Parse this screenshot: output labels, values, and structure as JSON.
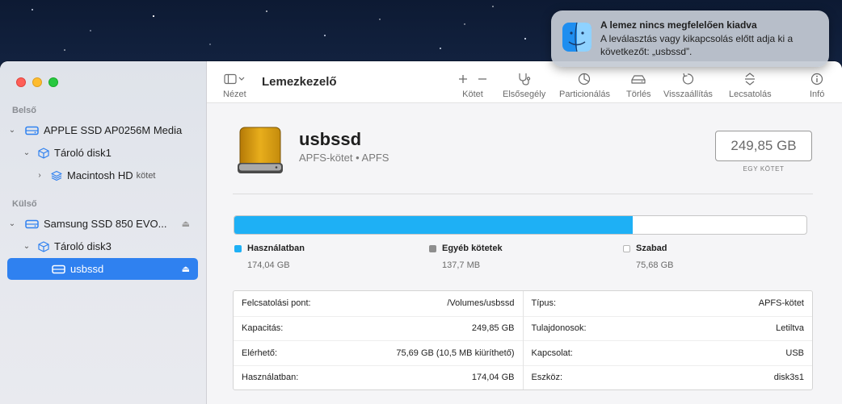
{
  "app": {
    "title": "Lemezkezelő"
  },
  "sidebar": {
    "sections": [
      {
        "title": "Belső"
      },
      {
        "title": "Külső"
      }
    ],
    "items": [
      {
        "label": "APPLE SSD AP0256M Media"
      },
      {
        "label": "Tároló disk1"
      },
      {
        "label": "Macintosh HD",
        "suffix": "kötet"
      },
      {
        "label": "Samsung SSD 850 EVO..."
      },
      {
        "label": "Tároló disk3"
      },
      {
        "label": "usbssd"
      }
    ]
  },
  "toolbar": {
    "view_label": "Nézet",
    "volume_label": "Kötet",
    "first_aid_label": "Elsősegély",
    "partition_label": "Particionálás",
    "erase_label": "Törlés",
    "restore_label": "Visszaállítás",
    "unmount_label": "Lecsatolás",
    "info_label": "Infó"
  },
  "volume": {
    "name": "usbssd",
    "subtitle": "APFS-kötet • APFS",
    "capacity": "249,85 GB",
    "capacity_caption": "EGY KÖTET",
    "usage_fraction": 0.6965
  },
  "legend": [
    {
      "label": "Használatban",
      "value": "174,04 GB",
      "color": "#1eb0f5"
    },
    {
      "label": "Egyéb kötetek",
      "value": "137,7 MB",
      "color": "#8e8e8e"
    },
    {
      "label": "Szabad",
      "value": "75,68 GB",
      "color": "#ffffff"
    }
  ],
  "info": {
    "left": [
      {
        "key": "Felcsatolási pont:",
        "value": "/Volumes/usbssd"
      },
      {
        "key": "Kapacitás:",
        "value": "249,85 GB"
      },
      {
        "key": "Elérhető:",
        "value": "75,69 GB (10,5 MB kiüríthető)"
      },
      {
        "key": "Használatban:",
        "value": "174,04 GB"
      }
    ],
    "right": [
      {
        "key": "Típus:",
        "value": "APFS-kötet"
      },
      {
        "key": "Tulajdonosok:",
        "value": "Letiltva"
      },
      {
        "key": "Kapcsolat:",
        "value": "USB"
      },
      {
        "key": "Eszköz:",
        "value": "disk3s1"
      }
    ]
  },
  "notification": {
    "title": "A lemez nincs megfelelően kiadva",
    "body": "A leválasztás vagy kikapcsolás előtt adja ki a következőt: „usbssd”."
  },
  "colors": {
    "accent": "#2f81f0",
    "used": "#1eb0f5",
    "disk_icon": "#d9a010"
  }
}
